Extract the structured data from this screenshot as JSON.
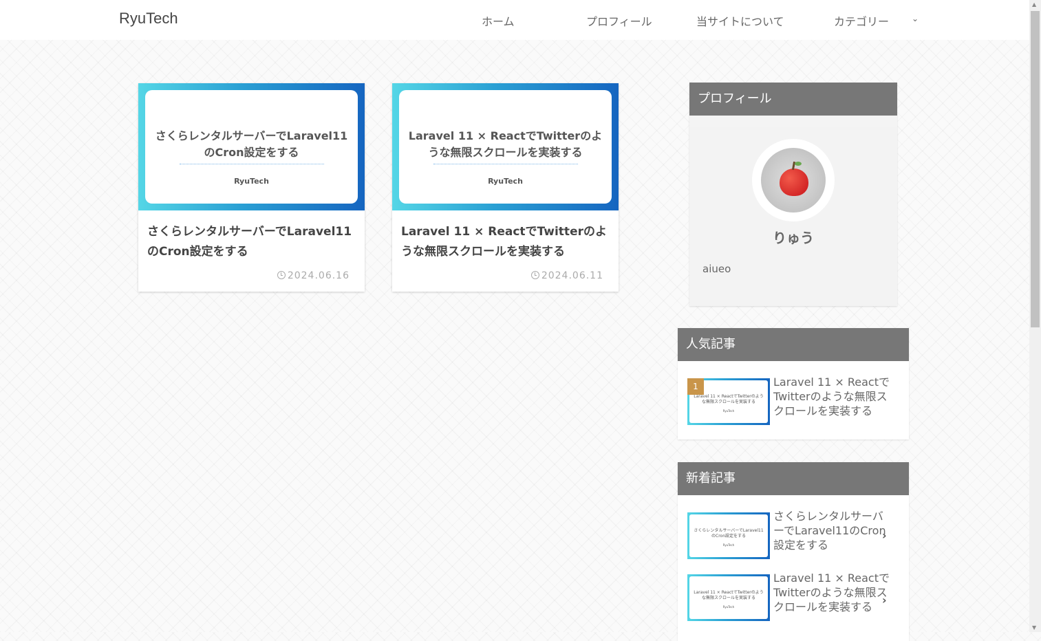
{
  "site": {
    "title": "RyuTech"
  },
  "nav": {
    "home": "ホーム",
    "profile": "プロフィール",
    "about": "当サイトについて",
    "category": "カテゴリー",
    "chevron_icon": "chevron-down-icon"
  },
  "posts": [
    {
      "thumb_title": "さくらレンタルサーバーでLaravel11のCron設定をする",
      "thumb_brand": "RyuTech",
      "title": "さくらレンタルサーバーでLaravel11のCron設定をする",
      "date": "2024.06.16"
    },
    {
      "thumb_title": "Laravel 11 × ReactでTwitterのような無限スクロールを実装する",
      "thumb_brand": "RyuTech",
      "title": "Laravel 11 × ReactでTwitterのような無限スクロールを実装する",
      "date": "2024.06.11"
    }
  ],
  "profile": {
    "heading": "プロフィール",
    "name": "りゅう",
    "bio": "aiueo"
  },
  "popular": {
    "heading": "人気記事",
    "items": [
      {
        "rank": "1",
        "thumb_title": "Laravel 11 × ReactでTwitterのような無限スクロールを実装する",
        "thumb_brand": "RyuTech",
        "title": "Laravel 11 × ReactでTwitterのような無限スクロールを実装する"
      }
    ]
  },
  "recent": {
    "heading": "新着記事",
    "items": [
      {
        "thumb_title": "さくらレンタルサーバーでLaravel11のCron設定をする",
        "thumb_brand": "RyuTech",
        "title": "さくらレンタルサーバーでLaravel11のCron設定をする"
      },
      {
        "thumb_title": "Laravel 11 × ReactでTwitterのような無限スクロールを実装する",
        "thumb_brand": "RyuTech",
        "title": "Laravel 11 × ReactでTwitterのような無限スクロールを実装する"
      }
    ]
  },
  "colors": {
    "widget_header": "#777777",
    "rank_badge": "#c9954a",
    "thumb_gradient_start": "#54d6e6",
    "thumb_gradient_end": "#1565c0"
  }
}
